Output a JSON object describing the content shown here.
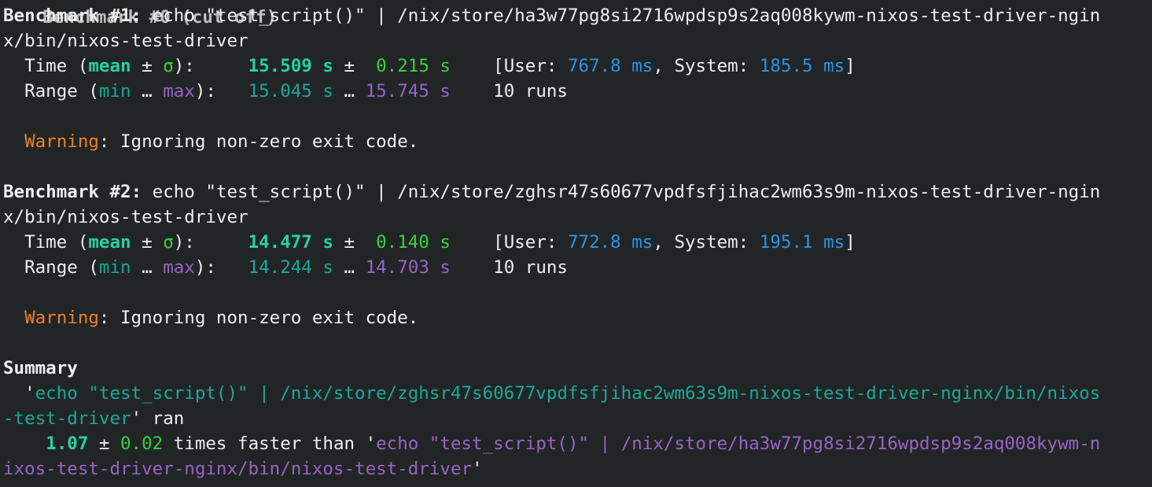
{
  "colors": {
    "background": "#222526",
    "foreground": "#eeeeee",
    "mean_green": "#25d39a",
    "sigma_green": "#33d33d",
    "min_cyan": "#1aa89a",
    "max_purple": "#9a62c6",
    "ms_blue": "#2b93e6",
    "warning_orange": "#ef7f25",
    "command_cyan": "#1aa89a",
    "command_purple": "#9a62c6"
  },
  "top_partial": "Benchmark #0 (cut off)",
  "benchmarks": [
    {
      "label": "Benchmark #1",
      "command_line_1": "echo \"test_script()\" | /nix/store/ha3w77pg8si2716wpdsp9s2aq008kywm-nixos-test-driver-ngin",
      "command_line_2": "x/bin/nixos-test-driver",
      "time_label": "Time (",
      "mean_word": "mean",
      "pm": "±",
      "sigma": "σ",
      "time_close": "):",
      "mean_value": "15.509 s",
      "sigma_value": "0.215 s",
      "user_label": "[User:",
      "user_value": "767.8 ms",
      "system_label": ", System:",
      "system_value": "185.5 ms",
      "close_bracket": "]",
      "range_label": "Range (",
      "min_word": "min",
      "ellipsis": "…",
      "max_word": "max",
      "range_close": "):",
      "min_value": "15.045 s",
      "max_value": "15.745 s",
      "runs": "10 runs",
      "warning_word": "Warning",
      "warning_text": ": Ignoring non-zero exit code."
    },
    {
      "label": "Benchmark #2",
      "command_line_1": "echo \"test_script()\" | /nix/store/zghsr47s60677vpdfsfjihac2wm63s9m-nixos-test-driver-ngin",
      "command_line_2": "x/bin/nixos-test-driver",
      "time_label": "Time (",
      "mean_word": "mean",
      "pm": "±",
      "sigma": "σ",
      "time_close": "):",
      "mean_value": "14.477 s",
      "sigma_value": "0.140 s",
      "user_label": "[User:",
      "user_value": "772.8 ms",
      "system_label": ", System:",
      "system_value": "195.1 ms",
      "close_bracket": "]",
      "range_label": "Range (",
      "min_word": "min",
      "ellipsis": "…",
      "max_word": "max",
      "range_close": "):",
      "min_value": "14.244 s",
      "max_value": "14.703 s",
      "runs": "10 runs",
      "warning_word": "Warning",
      "warning_text": ": Ignoring non-zero exit code."
    }
  ],
  "summary": {
    "heading": "Summary",
    "quote_open": "'",
    "fast_cmd_line_1": "echo \"test_script()\" | /nix/store/zghsr47s60677vpdfsfjihac2wm63s9m-nixos-test-driver-nginx/bin/nixos",
    "fast_cmd_line_2": "-test-driver",
    "ran": "' ran",
    "factor": "1.07",
    "pm": "±",
    "factor_err": "0.02",
    "faster_text": "times faster than '",
    "slow_cmd_line_1": "echo \"test_script()\" | /nix/store/ha3w77pg8si2716wpdsp9s2aq008kywm-n",
    "slow_cmd_line_2": "ixos-test-driver-nginx/bin/nixos-test-driver",
    "quote_close": "'"
  }
}
